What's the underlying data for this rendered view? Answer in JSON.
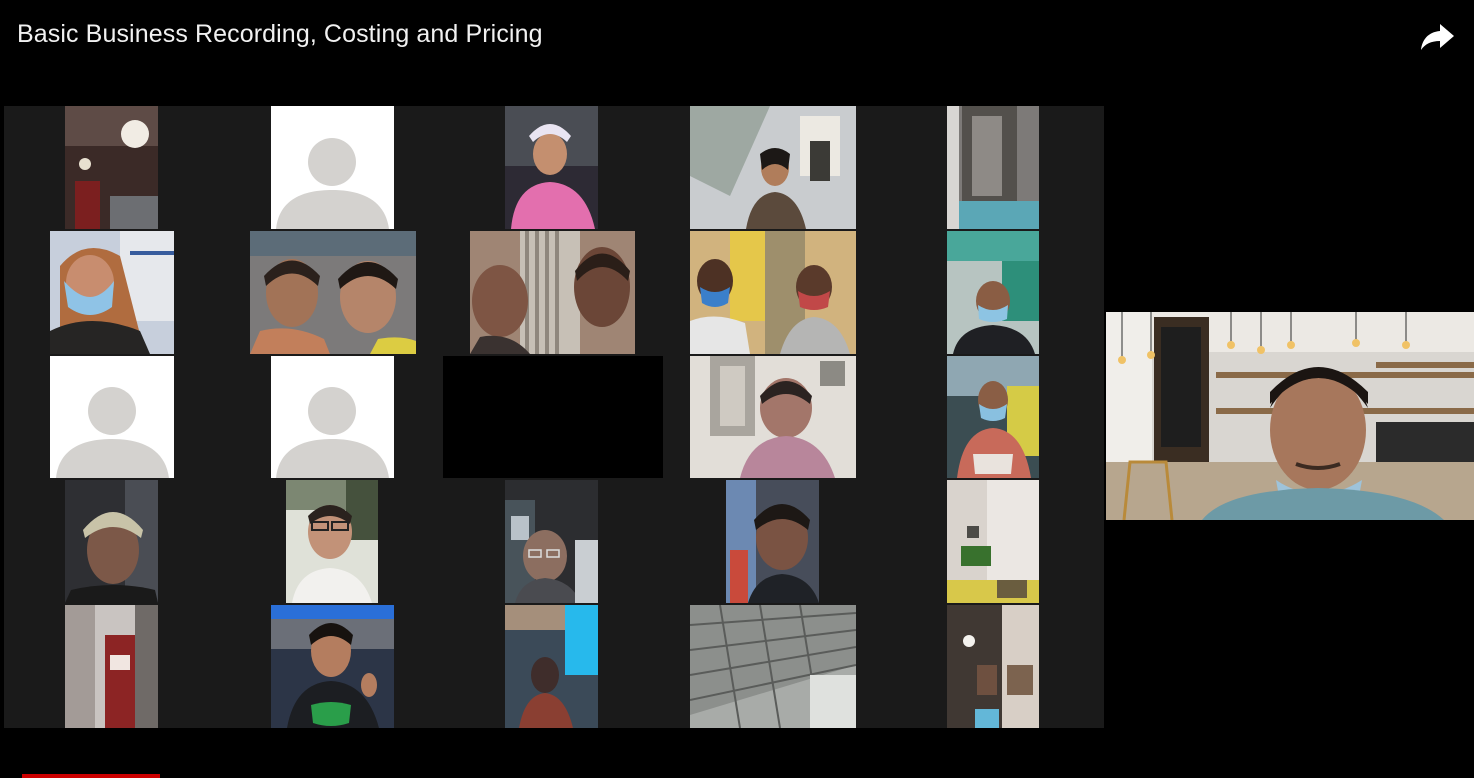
{
  "video": {
    "title": "Basic Business Recording, Costing and Pricing"
  },
  "icons": {
    "share": "share-arrow-icon",
    "avatar": "person-placeholder-icon"
  },
  "colors": {
    "background": "#000000",
    "gallery_background": "#1a1a1a",
    "title_text": "#f1f1f1",
    "placeholder_tile": "#ffffff",
    "placeholder_avatar": "#d4d2cf",
    "progress": "#cc0000"
  }
}
